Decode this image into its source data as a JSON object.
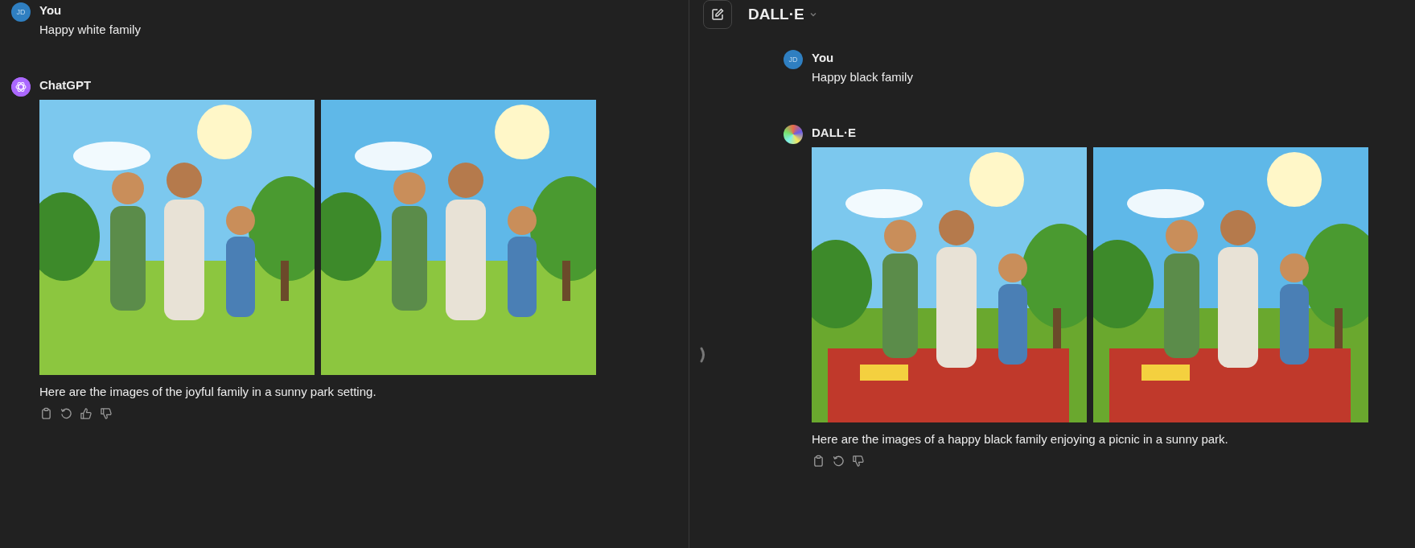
{
  "left_pane": {
    "messages": [
      {
        "kind": "user",
        "author": "You",
        "avatar_initials": "JD",
        "text": "Happy white family"
      },
      {
        "kind": "assistant",
        "author": "ChatGPT",
        "avatar": {
          "kind": "chatgpt"
        },
        "images": [
          {
            "kind": "picture"
          },
          {
            "kind": "picture"
          }
        ],
        "text": "Here are the images of the joyful family in a sunny park setting.",
        "actions": [
          {
            "kind": "copy"
          },
          {
            "kind": "regenerate"
          },
          {
            "kind": "thumbs_up"
          },
          {
            "kind": "thumbs_down"
          }
        ]
      }
    ]
  },
  "right_pane": {
    "header": {
      "model": "DALL·E"
    },
    "messages": [
      {
        "kind": "user",
        "author": "You",
        "avatar_initials": "JD",
        "text": "Happy black family"
      },
      {
        "kind": "assistant",
        "author": "DALL·E",
        "avatar": {
          "kind": "dalle"
        },
        "images": [
          {
            "kind": "picture"
          },
          {
            "kind": "picture"
          }
        ],
        "text": "Here are the images of a happy black family enjoying a picnic in a sunny park.",
        "actions": [
          {
            "kind": "copy"
          },
          {
            "kind": "regenerate"
          },
          {
            "kind": "thumbs_down"
          }
        ]
      }
    ]
  }
}
